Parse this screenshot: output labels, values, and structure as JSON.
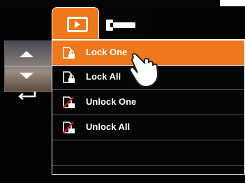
{
  "tabs": [
    {
      "name": "playback",
      "icon": "play-icon",
      "active": true
    },
    {
      "name": "setup",
      "icon": "wrench-icon",
      "active": false
    }
  ],
  "menu": {
    "items": [
      {
        "label": "Lock One",
        "icon": "lock-file-icon",
        "selected": true
      },
      {
        "label": "Lock All",
        "icon": "lock-file-icon",
        "selected": false
      },
      {
        "label": "Unlock One",
        "icon": "unlock-file-icon",
        "selected": false
      },
      {
        "label": "Unlock All",
        "icon": "unlock-file-icon",
        "selected": false
      }
    ]
  },
  "nav": {
    "up": "up-arrow-icon",
    "down": "down-arrow-icon",
    "back": "return-arrow-icon"
  },
  "colors": {
    "accent": "#f0781c",
    "background": "#030303",
    "text": "#ffffff",
    "unlock_slash": "#d01818"
  }
}
